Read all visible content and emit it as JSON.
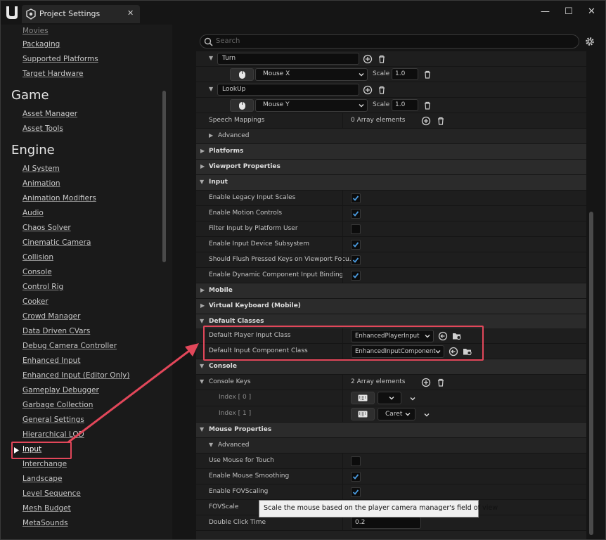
{
  "window": {
    "tab_title": "Project Settings",
    "close_symbol": "✕",
    "controls": {
      "minimize": "—",
      "maximize": "☐",
      "close": "✕"
    }
  },
  "sidebar": {
    "top_cut_item": "Movies",
    "items_top": [
      "Packaging",
      "Supported Platforms",
      "Target Hardware"
    ],
    "game_heading": "Game",
    "game_items": [
      "Asset Manager",
      "Asset Tools"
    ],
    "engine_heading": "Engine",
    "engine_items": [
      "AI System",
      "Animation",
      "Animation Modifiers",
      "Audio",
      "Chaos Solver",
      "Cinematic Camera",
      "Collision",
      "Console",
      "Control Rig",
      "Cooker",
      "Crowd Manager",
      "Data Driven CVars",
      "Debug Camera Controller",
      "Enhanced Input",
      "Enhanced Input (Editor Only)",
      "Gameplay Debugger",
      "Garbage Collection",
      "General Settings",
      "Hierarchical LOD",
      "Input",
      "Interchange",
      "Landscape",
      "Level Sequence",
      "Mesh Budget",
      "MetaSounds"
    ],
    "selected": "Input"
  },
  "search": {
    "placeholder": "Search"
  },
  "axis": {
    "turn": {
      "label": "Turn",
      "key": "Mouse X",
      "scale_label": "Scale",
      "scale": "1.0"
    },
    "lookup": {
      "label": "LookUp",
      "key": "Mouse Y",
      "scale_label": "Scale",
      "scale": "1.0"
    }
  },
  "speech": {
    "label": "Speech Mappings",
    "value": "0 Array elements"
  },
  "advanced_label": "Advanced",
  "categories": {
    "platforms": "Platforms",
    "viewport": "Viewport Properties",
    "input": "Input",
    "mobile": "Mobile",
    "virtual_keyboard": "Virtual Keyboard (Mobile)",
    "default_classes": "Default Classes",
    "console": "Console",
    "mouse": "Mouse Properties"
  },
  "input_props": [
    {
      "label": "Enable Legacy Input Scales",
      "checked": true
    },
    {
      "label": "Enable Motion Controls",
      "checked": true
    },
    {
      "label": "Filter Input by Platform User",
      "checked": false
    },
    {
      "label": "Enable Input Device Subsystem",
      "checked": true
    },
    {
      "label": "Should Flush Pressed Keys on Viewport Focu...",
      "checked": true
    },
    {
      "label": "Enable Dynamic Component Input Binding",
      "checked": true
    }
  ],
  "default_classes": {
    "player_input_label": "Default Player Input Class",
    "player_input_value": "EnhancedPlayerInput",
    "component_label": "Default Input Component Class",
    "component_value": "EnhancedInputComponent"
  },
  "console": {
    "keys_label": "Console Keys",
    "keys_value": "2 Array elements",
    "index0": "Index [ 0 ]",
    "index1": "Index [ 1 ]",
    "index1_key": "Caret"
  },
  "mouse": {
    "advanced": "Advanced",
    "use_touch": "Use Mouse for Touch",
    "smoothing": "Enable Mouse Smoothing",
    "fov_scaling": "Enable FOVScaling",
    "fov_scale": "FOVScale",
    "double_click": "Double Click Time",
    "double_click_value": "0.2",
    "use_touch_checked": false,
    "smoothing_checked": true,
    "fov_scaling_checked": true
  },
  "tooltip": "Scale the mouse based on the player camera manager's field of view",
  "colors": {
    "accent": "#e2475a",
    "check": "#4a9be0"
  }
}
